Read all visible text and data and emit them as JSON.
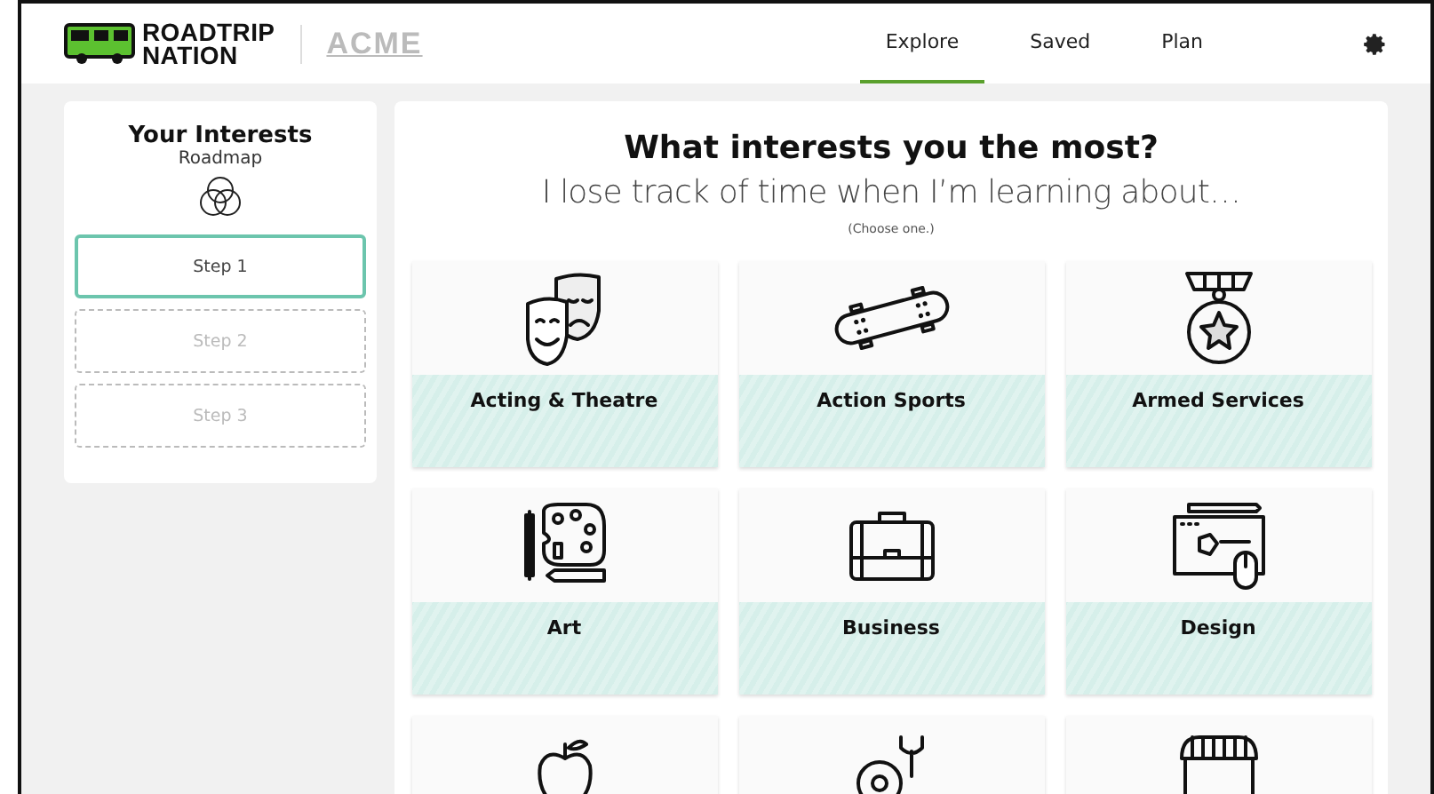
{
  "header": {
    "logo_text": [
      "ROADTRIP",
      "NATION"
    ],
    "partner": "ACME",
    "nav": [
      {
        "label": "Explore",
        "selected": true
      },
      {
        "label": "Saved",
        "selected": false
      },
      {
        "label": "Plan",
        "selected": false
      }
    ]
  },
  "sidebar": {
    "title": "Your Interests",
    "subtitle": "Roadmap",
    "steps": [
      {
        "label": "Step 1",
        "selected": true
      },
      {
        "label": "Step 2",
        "selected": false
      },
      {
        "label": "Step 3",
        "selected": false
      }
    ]
  },
  "main": {
    "heading": "What interests you the most?",
    "prompt": "I lose track of time when I’m learning about…",
    "hint": "(Choose one.)",
    "tiles": [
      {
        "kind": "masks",
        "label": "Acting & Theatre"
      },
      {
        "kind": "skateboard",
        "label": "Action Sports"
      },
      {
        "kind": "medal",
        "label": "Armed Services"
      },
      {
        "kind": "palette",
        "label": "Art"
      },
      {
        "kind": "briefcase",
        "label": "Business"
      },
      {
        "kind": "design",
        "label": "Design"
      },
      {
        "kind": "apple"
      },
      {
        "kind": "gear-wrench"
      },
      {
        "kind": "storefront"
      }
    ]
  }
}
